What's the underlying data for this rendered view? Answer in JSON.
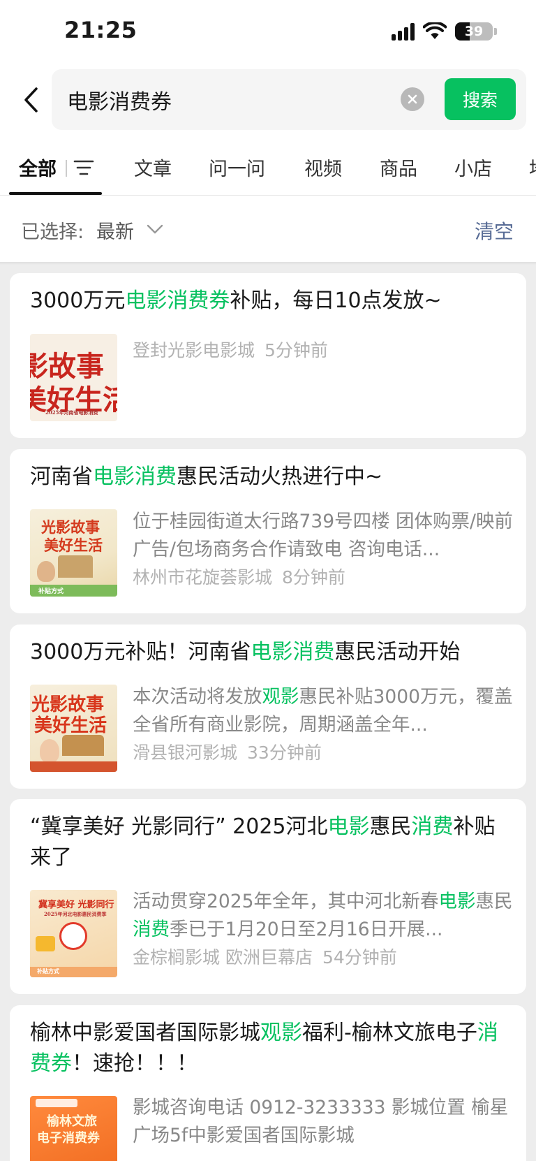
{
  "status_bar": {
    "time": "21:25",
    "battery": "39",
    "battery_level": 0.39
  },
  "search": {
    "query": "电影消费券",
    "button_label": "搜索"
  },
  "tabs": [
    {
      "label": "全部",
      "active": true
    },
    {
      "label": "文章"
    },
    {
      "label": "问一问"
    },
    {
      "label": "视频"
    },
    {
      "label": "商品"
    },
    {
      "label": "小店"
    },
    {
      "label": "地"
    }
  ],
  "filter": {
    "label": "已选择:",
    "value": "最新",
    "clear_label": "清空"
  },
  "colors": {
    "accent": "#07c160",
    "link": "#576b95",
    "meta": "#b2b2b2",
    "desc": "#888888"
  },
  "results": [
    {
      "title_parts": [
        {
          "text": "3000万元"
        },
        {
          "text": "电影消费券",
          "hl": true
        },
        {
          "text": "补贴，每日10点发放~"
        }
      ],
      "thumb_texts": [
        "影故事",
        "美好生活",
        "2025年河南省电影消费"
      ],
      "description": "",
      "source": "登封光影电影城",
      "time": "5分钟前"
    },
    {
      "title_parts": [
        {
          "text": "河南省"
        },
        {
          "text": "电影消费",
          "hl": true
        },
        {
          "text": "惠民活动火热进行中~"
        }
      ],
      "thumb_texts": [
        "光影故事",
        "美好生活",
        "补贴方式"
      ],
      "description": "位于桂园街道太行路739号四楼 团体购票/映前广告/包场商务合作请致电 咨询电话...",
      "source": "林州市花旋荟影城",
      "time": "8分钟前"
    },
    {
      "title_parts": [
        {
          "text": "3000万元补贴！河南省"
        },
        {
          "text": "电影消费",
          "hl": true
        },
        {
          "text": "惠民活动开始"
        }
      ],
      "thumb_texts": [
        "光影故事",
        "美好生活"
      ],
      "description_parts": [
        {
          "text": "本次活动将发放"
        },
        {
          "text": "观影",
          "hl": true
        },
        {
          "text": "惠民补贴3000万元，覆盖全省所有商业影院，周期涵盖全年..."
        }
      ],
      "source": "滑县银河影城",
      "time": "33分钟前"
    },
    {
      "title_parts": [
        {
          "text": "“冀享美好 光影同行” 2025河北"
        },
        {
          "text": "电影",
          "hl": true
        },
        {
          "text": "惠民"
        },
        {
          "text": "消费",
          "hl": true
        },
        {
          "text": "补贴来了"
        }
      ],
      "thumb_texts": [
        "冀享美好 光影同行",
        "2025年河北电影惠民消费季",
        "补贴方式"
      ],
      "description_parts": [
        {
          "text": "活动贯穿2025年全年，其中河北新春"
        },
        {
          "text": "电影",
          "hl": true
        },
        {
          "text": "惠民"
        },
        {
          "text": "消费",
          "hl": true
        },
        {
          "text": "季已于1月20日至2月16日开展..."
        }
      ],
      "source": "金棕榈影城 欧洲巨幕店",
      "time": "54分钟前"
    },
    {
      "title_parts": [
        {
          "text": "榆林中影爱国者国际影城"
        },
        {
          "text": "观影",
          "hl": true
        },
        {
          "text": "福利-榆林文旅电子"
        },
        {
          "text": "消费券",
          "hl": true
        },
        {
          "text": "！速抢！！！"
        }
      ],
      "thumb_texts": [
        "榆林文旅",
        "电子消费券"
      ],
      "description": "影城咨询电话 0912-3233333 影城位置 榆星广场5f中影爱国者国际影城",
      "source": "",
      "time": ""
    }
  ]
}
